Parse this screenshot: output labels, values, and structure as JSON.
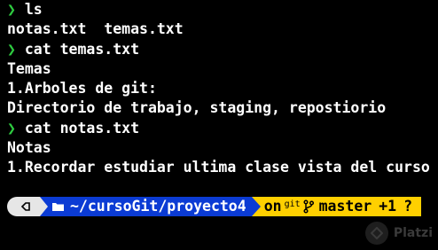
{
  "prompt_symbol": "❯",
  "lines": [
    {
      "kind": "cmd",
      "text": "ls"
    },
    {
      "kind": "out",
      "text": "notas.txt  temas.txt"
    },
    {
      "kind": "cmd",
      "text": "cat temas.txt"
    },
    {
      "kind": "out",
      "text": "Temas"
    },
    {
      "kind": "out",
      "text": "1.Arboles de git:"
    },
    {
      "kind": "out",
      "text": "Directorio de trabajo, staging, repostiorio"
    },
    {
      "kind": "cmd",
      "text": "cat notas.txt"
    },
    {
      "kind": "out",
      "text": "Notas"
    },
    {
      "kind": "out",
      "text": "1.Recordar estudiar ultima clase vista del curso"
    }
  ],
  "statusbar": {
    "path": "~/cursoGit/proyecto4",
    "on_label": "on",
    "git_small": "git",
    "branch": "master",
    "changes": "+1",
    "untracked": "?"
  },
  "watermark": {
    "text": "Platzi"
  },
  "colors": {
    "prompt": "#2ecc40",
    "dir_segment": "#0b3bd4",
    "git_segment": "#ffd000",
    "os_segment": "#e6e6e6"
  }
}
